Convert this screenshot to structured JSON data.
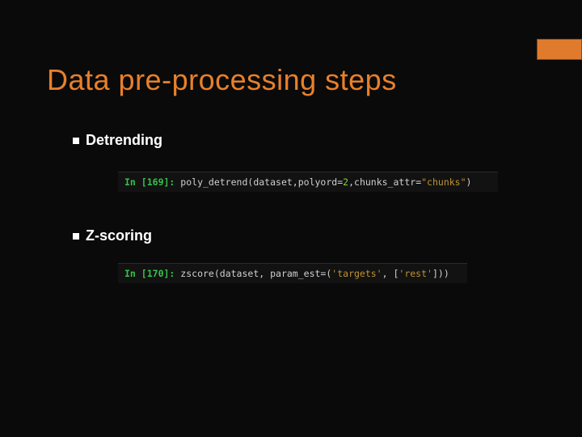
{
  "slide": {
    "title": "Data pre-processing steps",
    "bullets": {
      "b1": "Detrending",
      "b2": "Z-scoring"
    },
    "code1": {
      "prompt_in": "In ",
      "lbr": "[",
      "num": "169",
      "rbr": "]:",
      "sp": " ",
      "fn": "poly_detrend",
      "lp": "(",
      "a1": "dataset",
      "c1": ",",
      "a2": "polyord",
      "eq": "=",
      "v2": "2",
      "c2": ",",
      "a3": "chunks_attr",
      "eq2": "=",
      "v3": "\"chunks\"",
      "rp": ")"
    },
    "code2": {
      "prompt_in": "In ",
      "lbr": "[",
      "num": "170",
      "rbr": "]:",
      "sp": " ",
      "fn": "zscore",
      "lp": "(",
      "a1": "dataset",
      "c1": ", ",
      "a2": "param_est",
      "eq": "=",
      "lp2": "(",
      "v1": "'targets'",
      "c2": ", ",
      "lb": "[",
      "v2": "'rest'",
      "rb": "]",
      "rp2": ")",
      "rp": ")"
    }
  }
}
